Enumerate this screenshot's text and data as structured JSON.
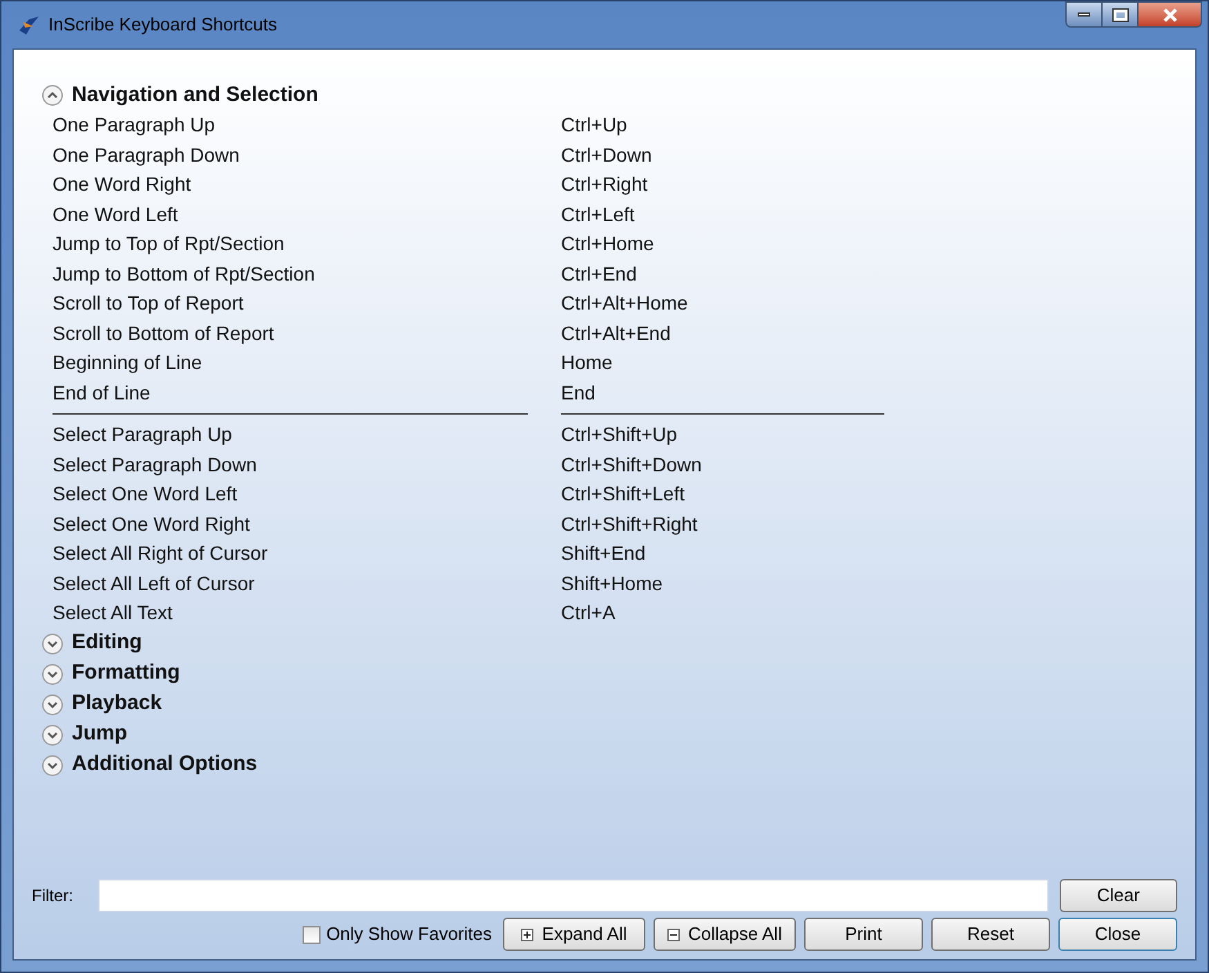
{
  "window": {
    "title": "InScribe Keyboard Shortcuts"
  },
  "sections": [
    {
      "title": "Navigation and Selection",
      "expanded": true,
      "groups": [
        [
          {
            "action": "One Paragraph Up",
            "keys": "Ctrl+Up"
          },
          {
            "action": "One Paragraph Down",
            "keys": "Ctrl+Down"
          },
          {
            "action": "One Word Right",
            "keys": "Ctrl+Right"
          },
          {
            "action": "One Word Left",
            "keys": "Ctrl+Left"
          },
          {
            "action": "Jump to Top of Rpt/Section",
            "keys": "Ctrl+Home"
          },
          {
            "action": "Jump to Bottom of Rpt/Section",
            "keys": "Ctrl+End"
          },
          {
            "action": "Scroll to Top of Report",
            "keys": "Ctrl+Alt+Home"
          },
          {
            "action": "Scroll to Bottom of Report",
            "keys": "Ctrl+Alt+End"
          },
          {
            "action": "Beginning of Line",
            "keys": "Home"
          },
          {
            "action": "End of Line",
            "keys": "End"
          }
        ],
        [
          {
            "action": "Select Paragraph Up",
            "keys": "Ctrl+Shift+Up"
          },
          {
            "action": "Select Paragraph Down",
            "keys": "Ctrl+Shift+Down"
          },
          {
            "action": "Select One Word Left",
            "keys": "Ctrl+Shift+Left"
          },
          {
            "action": "Select One Word Right",
            "keys": "Ctrl+Shift+Right"
          },
          {
            "action": "Select All Right of Cursor",
            "keys": "Shift+End"
          },
          {
            "action": "Select All Left of Cursor",
            "keys": "Shift+Home"
          },
          {
            "action": "Select All Text",
            "keys": "Ctrl+A"
          }
        ]
      ]
    },
    {
      "title": "Editing",
      "expanded": false
    },
    {
      "title": "Formatting",
      "expanded": false
    },
    {
      "title": "Playback",
      "expanded": false
    },
    {
      "title": "Jump",
      "expanded": false
    },
    {
      "title": "Additional Options",
      "expanded": false
    }
  ],
  "filter": {
    "label": "Filter:",
    "clear": "Clear"
  },
  "favorites": {
    "label": "Only Show Favorites",
    "checked": false
  },
  "buttons": [
    {
      "kind": "expand",
      "label": "Expand All"
    },
    {
      "kind": "collapse",
      "label": "Collapse All"
    },
    {
      "kind": "plain",
      "label": "Print"
    },
    {
      "kind": "plain",
      "label": "Reset"
    },
    {
      "kind": "default",
      "label": "Close"
    }
  ]
}
